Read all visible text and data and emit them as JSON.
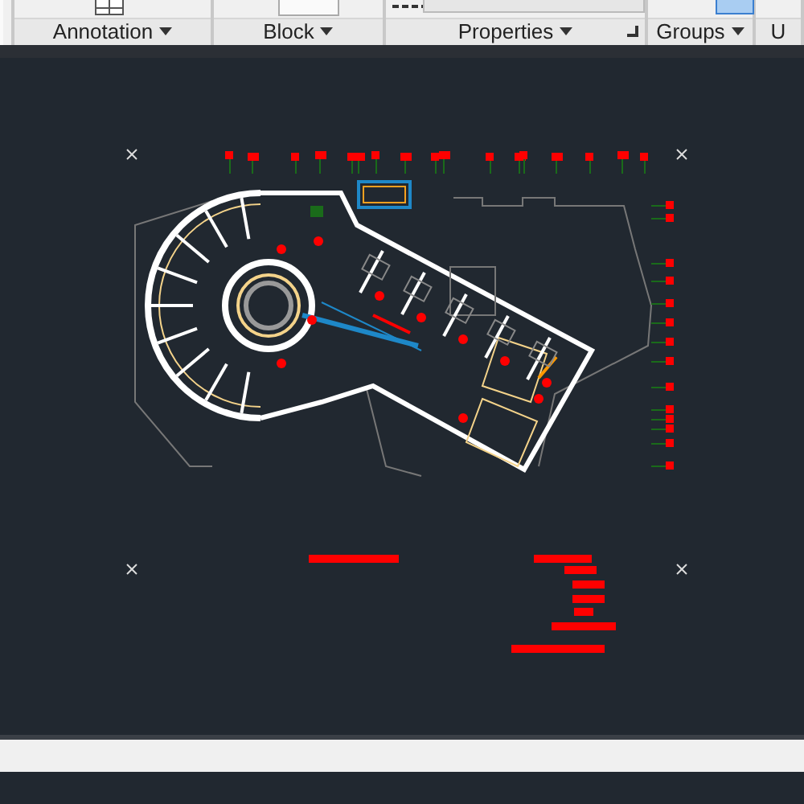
{
  "ribbon": {
    "panels": [
      {
        "label": "Annotation",
        "launcher": false
      },
      {
        "label": "Block",
        "launcher": false
      },
      {
        "label": "Properties",
        "launcher": true
      },
      {
        "label": "Groups",
        "launcher": false
      },
      {
        "label": "U",
        "launcher": false
      }
    ]
  }
}
